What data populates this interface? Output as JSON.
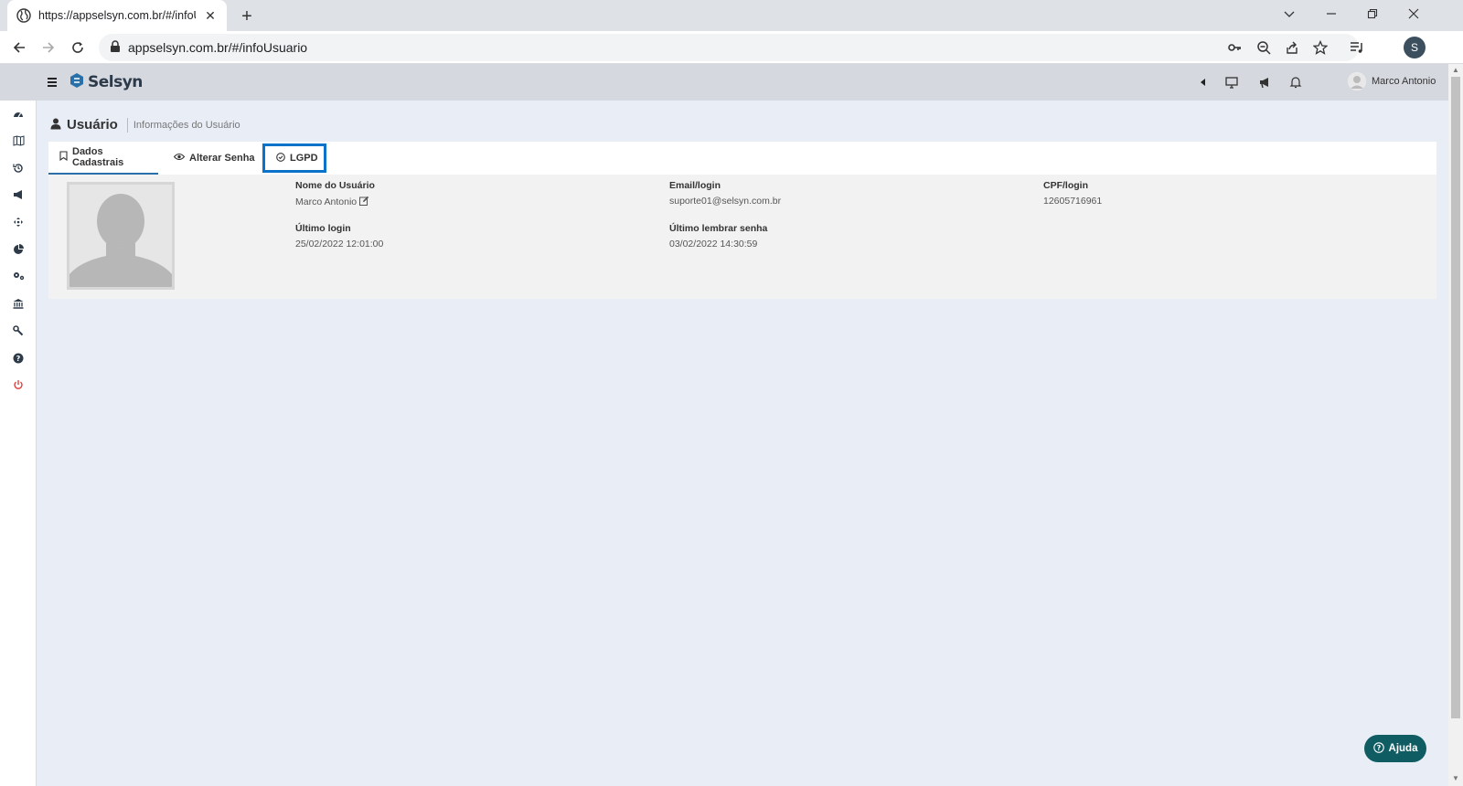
{
  "browser": {
    "tab_title": "https://appselsyn.com.br/#/infoU",
    "url": "appselsyn.com.br/#/infoUsuario",
    "profile_initial": "S"
  },
  "header": {
    "logo_text": "Selsyn",
    "user_name": "Marco Antonio"
  },
  "page": {
    "title": "Usuário",
    "subtitle": "Informações do Usuário"
  },
  "tabs": [
    {
      "label": "Dados Cadastrais",
      "icon": "bookmark-icon",
      "state": "active"
    },
    {
      "label": "Alterar Senha",
      "icon": "eye-icon"
    },
    {
      "label": "LGPD",
      "icon": "check-circle-icon",
      "state": "highlighted"
    }
  ],
  "user_info": {
    "name_label": "Nome do Usuário",
    "name_value": "Marco Antonio",
    "email_label": "Email/login",
    "email_value": "suporte01@selsyn.com.br",
    "cpf_label": "CPF/login",
    "cpf_value": "12605716961",
    "last_login_label": "Último login",
    "last_login_value": "25/02/2022 12:01:00",
    "last_reminder_label": "Último lembrar senha",
    "last_reminder_value": "03/02/2022 14:30:59"
  },
  "help_button": {
    "label": "Ajuda"
  },
  "sidebar_icons": [
    "dashboard-icon",
    "map-icon",
    "history-icon",
    "megaphone-icon",
    "move-icon",
    "pie-chart-icon",
    "settings-icon",
    "bank-icon",
    "wrench-icon",
    "help-circle-icon",
    "power-icon"
  ],
  "colors": {
    "accent": "#0b72c9",
    "help_button": "#0f5c62",
    "power_icon": "#e04040",
    "header_bg": "#d5d8de"
  }
}
